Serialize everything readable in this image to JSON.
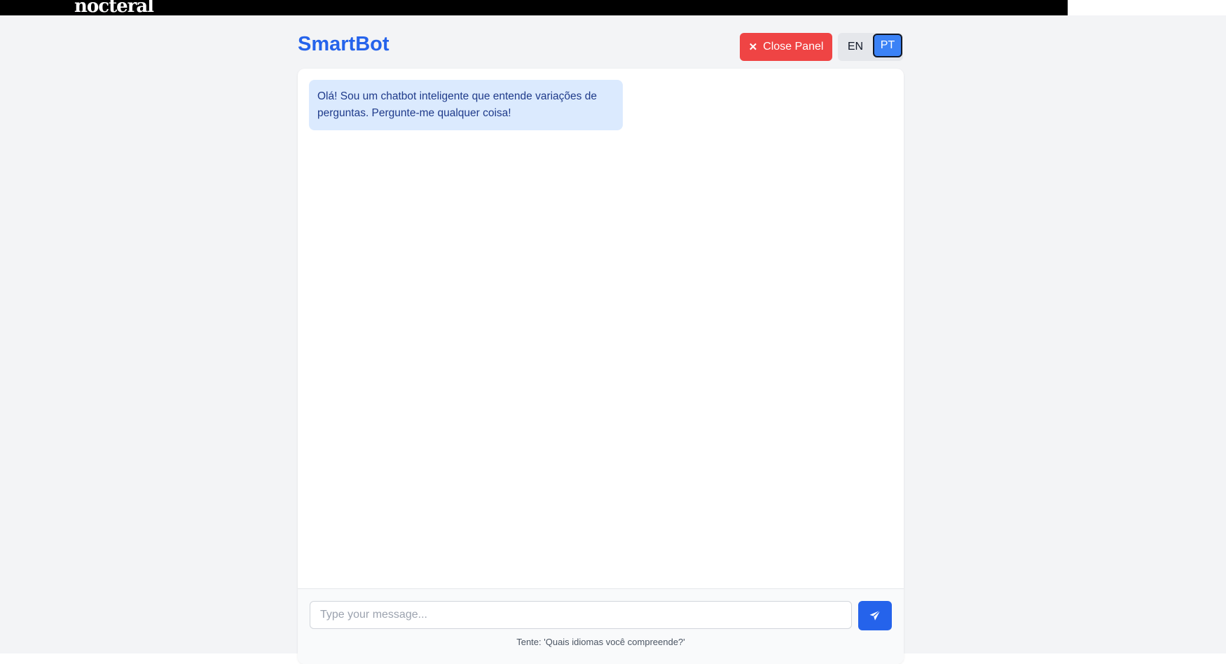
{
  "topbar": {
    "logo_text": "nocteral"
  },
  "header": {
    "brand": "SmartBot",
    "close_label": "Close Panel",
    "lang_en": "EN",
    "lang_pt": "PT",
    "active_lang": "PT"
  },
  "chat": {
    "messages": [
      {
        "sender": "bot",
        "text": "Olá! Sou um chatbot inteligente que entende variações de perguntas. Pergunte-me qualquer coisa!"
      }
    ],
    "input_placeholder": "Type your message...",
    "input_value": "",
    "hint": "Tente: 'Quais idiomas você compreende?'"
  },
  "colors": {
    "brand": "#2563eb",
    "close_button": "#ef4444",
    "active_lang": "#3b82f6",
    "bot_bubble": "#dbeafe",
    "background": "#f3f4f6"
  },
  "icons": {
    "close": "close-icon",
    "send": "send-icon"
  }
}
